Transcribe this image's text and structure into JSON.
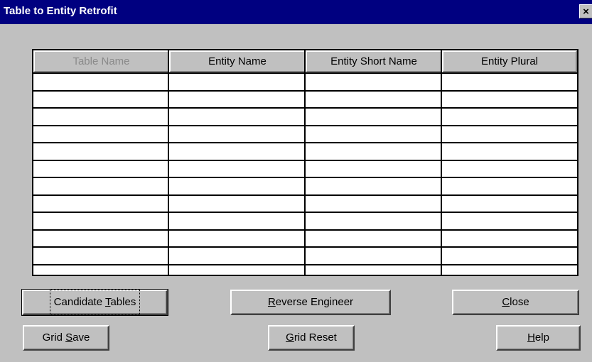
{
  "window": {
    "title": "Table to Entity Retrofit",
    "close_glyph": "×"
  },
  "grid": {
    "columns": [
      "Table Name",
      "Entity Name",
      "Entity Short Name",
      "Entity Plural"
    ],
    "disabled_columns": [
      "Table Name"
    ],
    "empty_rows": 11
  },
  "buttons": {
    "candidate_tables": {
      "before": "Candidate ",
      "mnemonic": "T",
      "after": "ables"
    },
    "reverse_engineer": {
      "before": "",
      "mnemonic": "R",
      "after": "everse Engineer"
    },
    "close": {
      "before": "",
      "mnemonic": "C",
      "after": "lose"
    },
    "grid_save": {
      "before": "Grid ",
      "mnemonic": "S",
      "after": "ave"
    },
    "grid_reset": {
      "before": "",
      "mnemonic": "G",
      "after": "rid Reset"
    },
    "help": {
      "before": "",
      "mnemonic": "H",
      "after": "elp"
    }
  },
  "colors": {
    "title_bar": "#000080",
    "face": "#c0c0c0"
  }
}
